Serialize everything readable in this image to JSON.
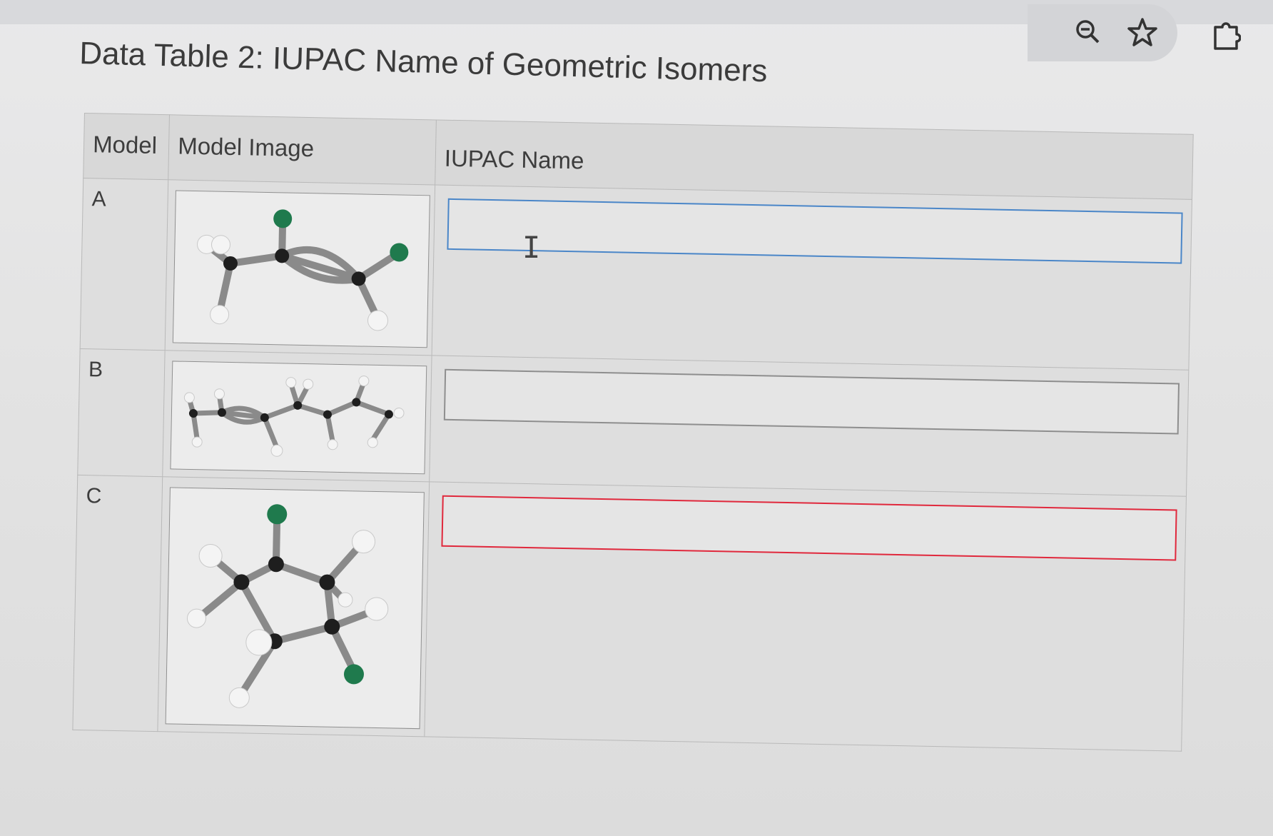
{
  "title": "Data Table 2: IUPAC Name of Geometric Isomers",
  "browser": {
    "icons": [
      "zoom-out-icon",
      "bookmark-star-icon",
      "extensions-icon"
    ]
  },
  "table": {
    "headers": {
      "model": "Model",
      "image": "Model Image",
      "name": "IUPAC Name"
    },
    "rows": [
      {
        "model": "A",
        "image_desc": "ball-and-stick molecule model",
        "answer": "",
        "state": "focused"
      },
      {
        "model": "B",
        "image_desc": "ball-and-stick molecule model",
        "answer": "",
        "state": "default"
      },
      {
        "model": "C",
        "image_desc": "ball-and-stick molecule model",
        "answer": "",
        "state": "invalid"
      }
    ]
  },
  "colors": {
    "focus_border": "#4a86c8",
    "error_border": "#e0283c",
    "chlorine_atom": "#1f7a4d",
    "carbon_atom": "#1e1e1e",
    "hydrogen_atom": "#f4f4f4"
  }
}
